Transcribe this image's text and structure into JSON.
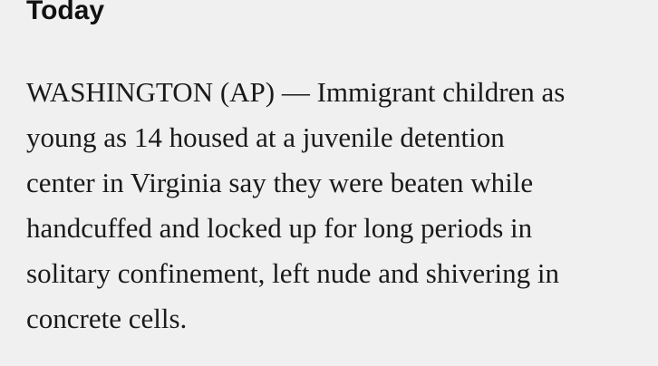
{
  "section": {
    "heading": "Today"
  },
  "article": {
    "lines": [
      "WASHINGTON (AP) — Immigrant children as",
      "young as 14 housed at a juvenile detention",
      "center in Virginia say they were beaten while",
      "handcuffed and locked up for long periods in",
      "solitary confinement, left nude and shivering in",
      "concrete cells."
    ]
  },
  "colors": {
    "background": "#f0f0f0",
    "text": "#1a1a1a"
  }
}
